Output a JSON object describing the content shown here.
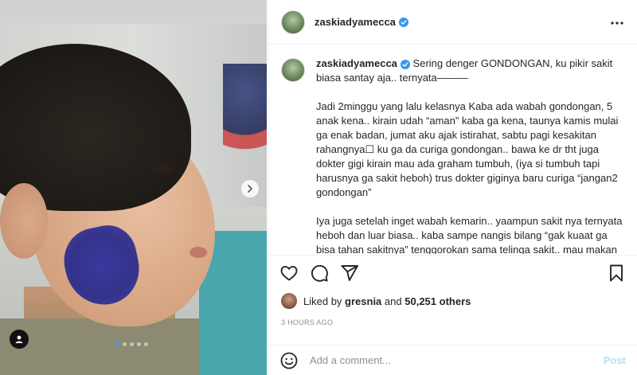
{
  "post": {
    "username": "zaskiadyamecca",
    "verified": true,
    "caption": {
      "intro": "Sering denger GONDONGAN, ku pikir sakit biasa santay aja.. ternyata———",
      "paragraph1": "Jadi 2minggu yang lalu kelasnya Kaba ada wabah gondongan, 5 anak kena.. kirain udah “aman” kaba ga kena, taunya kamis mulai ga enak badan, jumat aku ajak istirahat, sabtu pagi kesakitan rahangnya☐ ku ga da curiga gondongan.. bawa ke dr tht juga dokter gigi kirain mau ada graham tumbuh, (iya si tumbuh tapi harusnya ga sakit heboh) trus dokter giginya baru curiga “jangan2 gondongan”",
      "paragraph2": "Iya juga setelah inget wabah kemarin.. yaampun sakit nya ternyata heboh dan luar biasa.. kaba sampe nangis bilang “gak kuaat ga bisa tahan sakitnya” tenggorokan sama telinga sakit.. mau makan tapi makan ga bisa"
    },
    "likes": {
      "prefix": "Liked by",
      "by_user": "gresnia",
      "and": "and",
      "count_text": "50,251 others"
    },
    "timestamp": "3 HOURS AGO"
  },
  "comment": {
    "placeholder": "Add a comment...",
    "post_label": "Post"
  },
  "carousel": {
    "slides": 5,
    "active": 1
  },
  "icons": {
    "more": "more-options-icon",
    "like": "heart-icon",
    "comment": "comment-icon",
    "share": "share-icon",
    "save": "bookmark-icon",
    "emoji": "emoji-icon",
    "next": "chevron-right-icon",
    "user_tag": "user-tag-icon"
  },
  "colors": {
    "verified": "#3897f0",
    "post_button": "#b2dffc",
    "muted": "#8e8e8e"
  }
}
